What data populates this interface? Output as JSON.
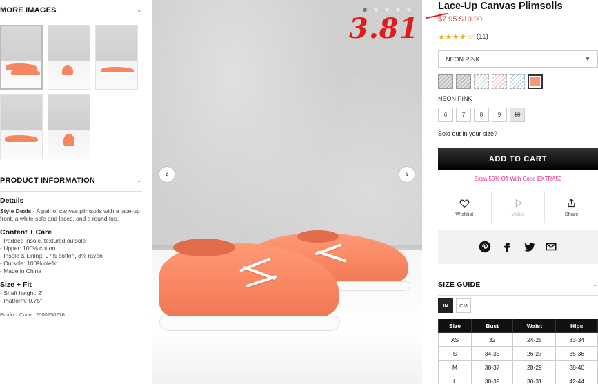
{
  "more_images": {
    "heading": "MORE IMAGES",
    "toggle": "-"
  },
  "product_info": {
    "heading": "PRODUCT INFORMATION",
    "toggle": "-",
    "details_heading": "Details",
    "details_brand": "Style Deals",
    "details_text": " - A pair of canvas plimsolls with a lace-up front, a white sole and laces, and a round toe.",
    "content_heading": "Content + Care",
    "content_lines": [
      "- Padded insole, textured outsole",
      "- Upper: 100% cotton",
      "- Insole & Lining: 97% cotton, 3% rayon",
      "- Outsole: 100% olefin",
      "- Made in China"
    ],
    "size_heading": "Size + Fit",
    "size_lines": [
      "- Shaft height: 2\"",
      "- Platform: 0.75\""
    ],
    "product_code": "Product Code : 2000250276"
  },
  "product": {
    "title": "Lace-Up Canvas Plimsolls",
    "old_price_1": "$7.95",
    "old_price_2": "$10.90",
    "sale_overlay": "3.81",
    "stars": "★★★★☆",
    "review_count": "(11)"
  },
  "color_select": {
    "value": "NEON PINK",
    "caret": "▼"
  },
  "color_label": "NEON PINK",
  "sizes": [
    {
      "label": "6",
      "available": true
    },
    {
      "label": "7",
      "available": true
    },
    {
      "label": "8",
      "available": true
    },
    {
      "label": "9",
      "available": true
    },
    {
      "label": "10",
      "available": false
    }
  ],
  "sold_out_link": "Sold out in your size?",
  "add_to_cart": "ADD TO CART",
  "promo": "Extra 50% Off With Code EXTRA50",
  "actions": {
    "wishlist": "Wishlist",
    "video": "Video",
    "share": "Share"
  },
  "size_guide": {
    "heading": "SIZE GUIDE",
    "toggle": "-",
    "units": [
      "IN",
      "CM"
    ],
    "columns": [
      "Size",
      "Bust",
      "Waist",
      "Hips"
    ],
    "rows": [
      [
        "XS",
        "32",
        "24-25",
        "33-34"
      ],
      [
        "S",
        "34-35",
        "26-27",
        "35-36"
      ],
      [
        "M",
        "38-37",
        "28-29",
        "38-40"
      ],
      [
        "L",
        "38-39",
        "30-31",
        "42-44"
      ]
    ]
  },
  "icons": {
    "wishlist": "heart-icon",
    "video": "play-icon",
    "share": "share-icon",
    "pinterest": "pinterest-icon",
    "facebook": "facebook-icon",
    "twitter": "twitter-icon",
    "email": "email-icon"
  },
  "colors": {
    "accent_pink": "#e0267a",
    "sale_red": "#e01b1b",
    "shoe_coral": "#f7845f",
    "star_gold": "#e8b32c"
  }
}
